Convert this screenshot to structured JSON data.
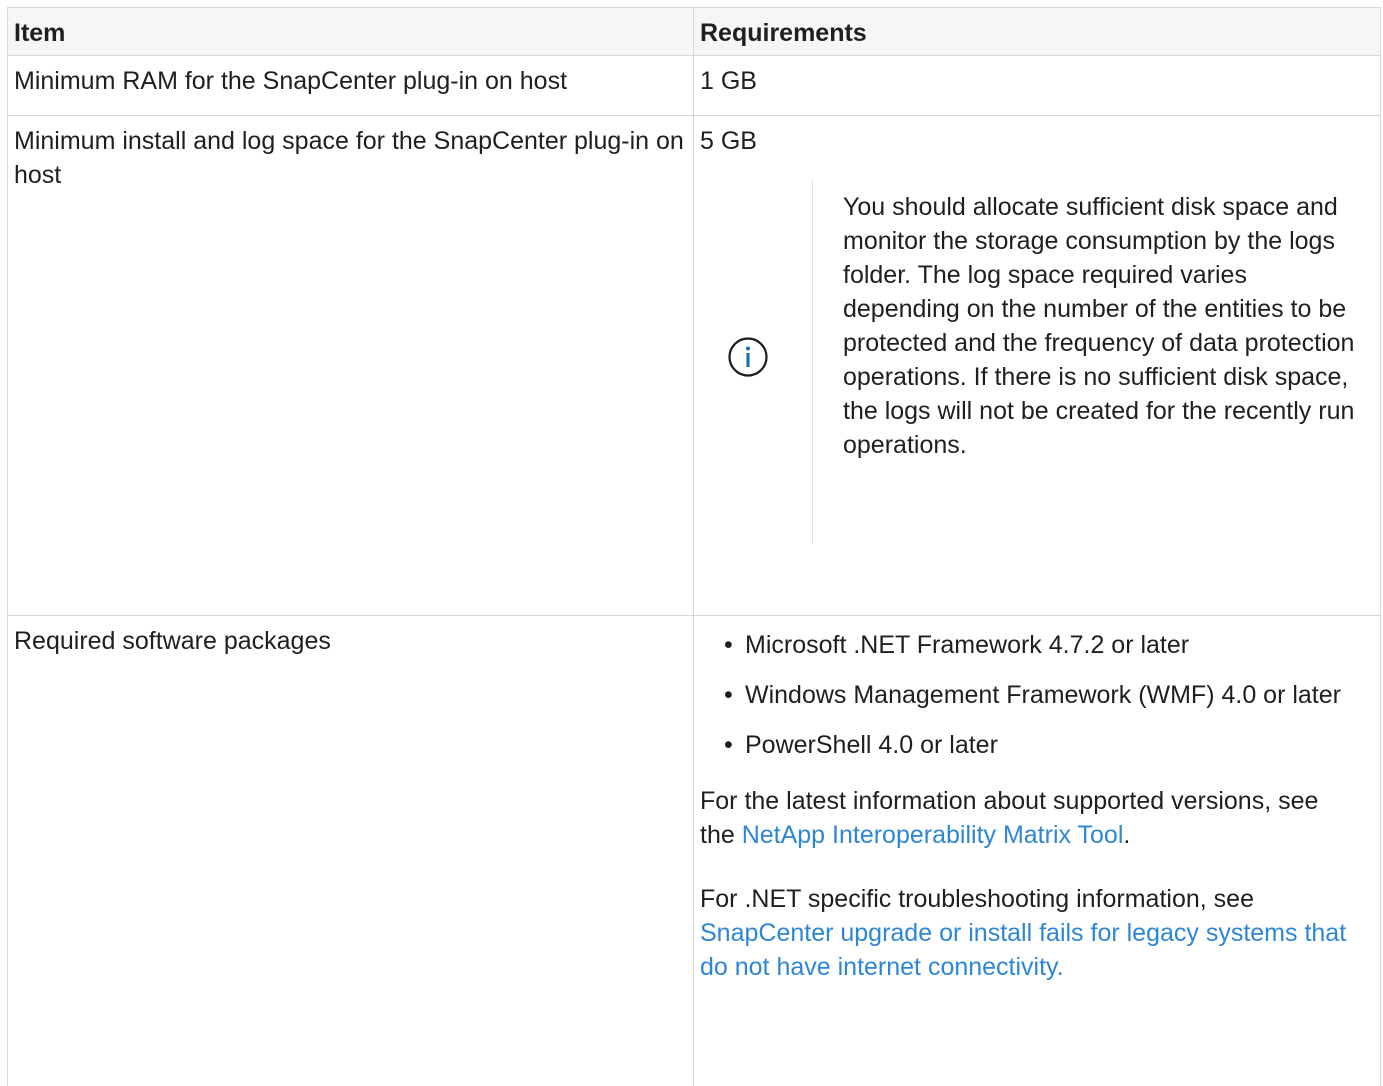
{
  "table": {
    "headers": {
      "item": "Item",
      "requirements": "Requirements"
    },
    "rows": [
      {
        "item": "Minimum RAM for the SnapCenter plug-in on host",
        "requirement": "1 GB"
      },
      {
        "item": "Minimum install and log space for the SnapCenter plug-in on host",
        "requirement": "5 GB",
        "note": {
          "icon": "info-circle-icon",
          "text": "You should allocate sufficient disk space and monitor the storage consumption by the logs folder. The log space required varies depending on the number of the entities to be protected and the frequency of data protection operations. If there is no sufficient disk space, the logs will not be created for the recently run operations."
        }
      },
      {
        "item": "Required software packages",
        "bullets": [
          "Microsoft .NET Framework 4.7.2 or later",
          "Windows Management Framework (WMF) 4.0 or later",
          "PowerShell 4.0 or later"
        ],
        "para1": {
          "before": "For the latest information about supported versions, see the ",
          "link": "NetApp Interoperability Matrix Tool",
          "after": "."
        },
        "para2": {
          "before": "For .NET specific troubleshooting information, see ",
          "link": "SnapCenter upgrade or install fails for legacy systems that do not have internet connectivity."
        }
      }
    ]
  },
  "colors": {
    "link": "#2e86d6",
    "icon": "#1f6fb5",
    "border": "#d7d7d7",
    "header_bg": "#f6f6f6"
  }
}
